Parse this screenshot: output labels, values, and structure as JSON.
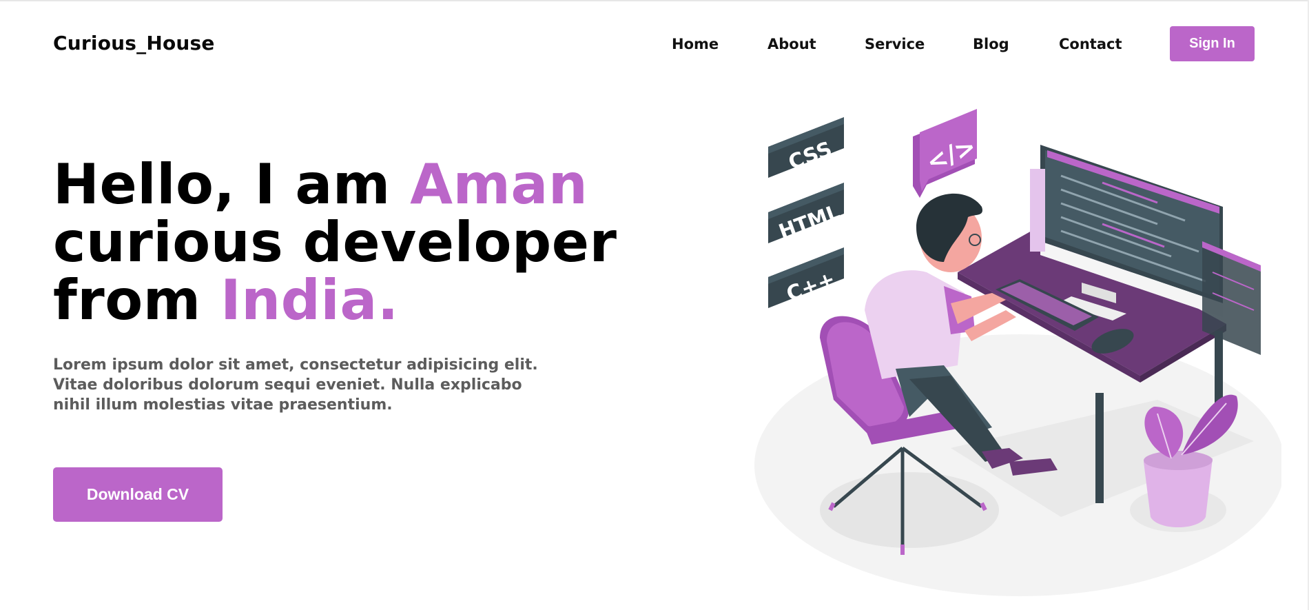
{
  "brand": "Curious_House",
  "nav": {
    "items": [
      {
        "label": "Home"
      },
      {
        "label": "About"
      },
      {
        "label": "Service"
      },
      {
        "label": "Blog"
      },
      {
        "label": "Contact"
      }
    ],
    "signin_label": "Sign In"
  },
  "hero": {
    "line1_prefix": "Hello, I am ",
    "line1_accent": "Aman",
    "line2": "curious developer",
    "line3_prefix": "from ",
    "line3_accent": "India.",
    "lead": "Lorem ipsum dolor sit amet, consectetur adipisicing elit. Vitae doloribus dolorum sequi eveniet. Nulla explicabo nihil illum molestias vitae praesentium.",
    "cta_label": "Download CV"
  },
  "illustration": {
    "tags": [
      "CSS",
      "HTML",
      "C++"
    ],
    "code_bubble": "</>"
  },
  "colors": {
    "accent": "#bb66c9",
    "dark_slate": "#37474f",
    "desk": "#6b3a77"
  }
}
